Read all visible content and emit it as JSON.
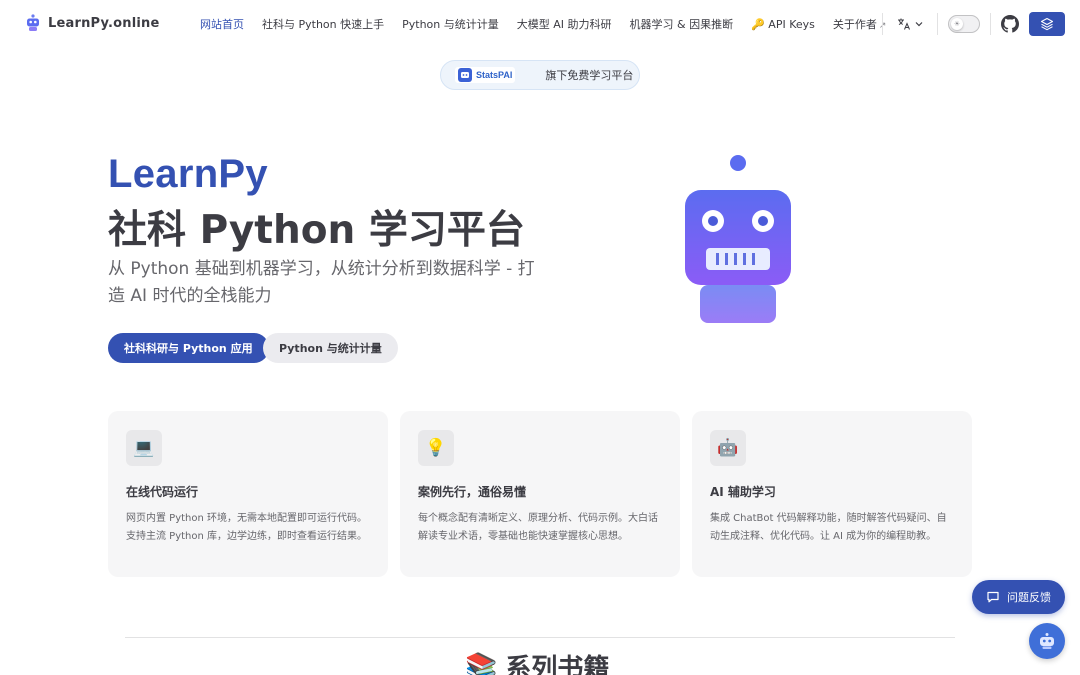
{
  "site": {
    "title": "LearnPy.online"
  },
  "nav": {
    "links": [
      {
        "label": "网站首页",
        "active": true
      },
      {
        "label": "社科与 Python 快速上手"
      },
      {
        "label": "Python 与统计计量"
      },
      {
        "label": "大模型 AI 助力科研"
      },
      {
        "label": "机器学习 & 因果推断"
      },
      {
        "label": "🔑 API Keys"
      },
      {
        "label": "关于作者",
        "external": "↗"
      }
    ],
    "language_icon": "translate-icon",
    "theme_toggle": "light-mode",
    "github_icon": "github-icon",
    "layers_icon": "layers-icon"
  },
  "banner": {
    "logo_text": "StatsPAI",
    "text": "旗下免费学习平台"
  },
  "hero": {
    "name": "LearnPy",
    "title": "社科 Python 学习平台",
    "tagline": "从 Python 基础到机器学习，从统计分析到数据科学 - 打造 AI 时代的全栈能力",
    "actions": [
      {
        "label": "社科科研与 Python 应用"
      },
      {
        "label": "Python 与统计计量"
      }
    ]
  },
  "features": [
    {
      "icon": "💻",
      "title": "在线代码运行",
      "desc": "网页内置 Python 环境，无需本地配置即可运行代码。支持主流 Python 库，边学边练，即时查看运行结果。"
    },
    {
      "icon": "💡",
      "title": "案例先行，通俗易懂",
      "desc": "每个概念配有清晰定义、原理分析、代码示例。大白话解读专业术语，零基础也能快速掌握核心思想。"
    },
    {
      "icon": "🤖",
      "title": "AI 辅助学习",
      "desc": "集成 ChatBot 代码解释功能，随时解答代码疑问、自动生成注释、优化代码。让 AI 成为你的编程助教。"
    }
  ],
  "feedback": {
    "label": "问题反馈"
  },
  "section": {
    "icon": "📚",
    "title": "系列书籍"
  },
  "colors": {
    "brand": "#3451b2",
    "robot_top": "#5b6cf0",
    "robot_bottom": "#8b5cf6"
  }
}
